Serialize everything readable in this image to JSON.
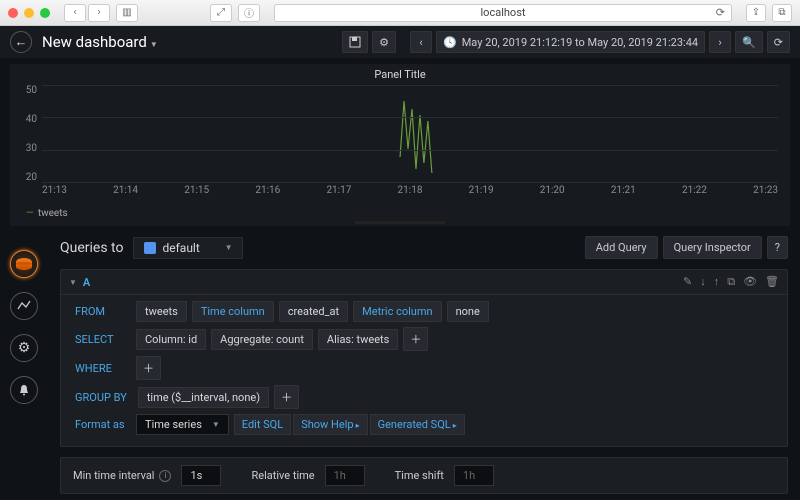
{
  "browser": {
    "url": "localhost"
  },
  "header": {
    "title": "New dashboard",
    "time_range": "May 20, 2019 21:12:19 to May 20, 2019 21:23:44"
  },
  "panel": {
    "title": "Panel Title"
  },
  "chart_data": {
    "type": "line",
    "title": "Panel Title",
    "xlabel": "",
    "ylabel": "",
    "ylim": [
      20,
      50
    ],
    "y_ticks": [
      50,
      40,
      30,
      20
    ],
    "x_ticks": [
      "21:13",
      "21:14",
      "21:15",
      "21:16",
      "21:17",
      "21:18",
      "21:19",
      "21:20",
      "21:21",
      "21:22",
      "21:23"
    ],
    "series": [
      {
        "name": "tweets",
        "color": "#6a9f3c",
        "x": [
          "21:17:50",
          "21:17:55",
          "21:18:00",
          "21:18:05",
          "21:18:10",
          "21:18:15",
          "21:18:20",
          "21:18:25",
          "21:18:30"
        ],
        "values": [
          28,
          45,
          30,
          42,
          24,
          40,
          26,
          38,
          22
        ]
      }
    ]
  },
  "queries": {
    "label": "Queries to",
    "datasource": "default",
    "buttons": {
      "add": "Add Query",
      "inspector": "Query Inspector",
      "help": "?"
    },
    "query_letter": "A",
    "rows": {
      "from": {
        "kw": "FROM",
        "table": "tweets",
        "time_col_label": "Time column",
        "time_col": "created_at",
        "metric_col_label": "Metric column",
        "metric_col": "none"
      },
      "select": {
        "kw": "SELECT",
        "column": "Column: id",
        "agg": "Aggregate: count",
        "alias": "Alias: tweets"
      },
      "where": {
        "kw": "WHERE"
      },
      "groupby": {
        "kw": "GROUP BY",
        "expr": "time ($__interval, none)"
      },
      "format": {
        "kw": "Format as",
        "value": "Time series",
        "edit": "Edit SQL",
        "showhelp": "Show Help",
        "generated": "Generated SQL"
      }
    }
  },
  "bottom": {
    "min_interval_label": "Min time interval",
    "min_interval": "1s",
    "relative_label": "Relative time",
    "relative": "1h",
    "shift_label": "Time shift",
    "shift": "1h"
  }
}
